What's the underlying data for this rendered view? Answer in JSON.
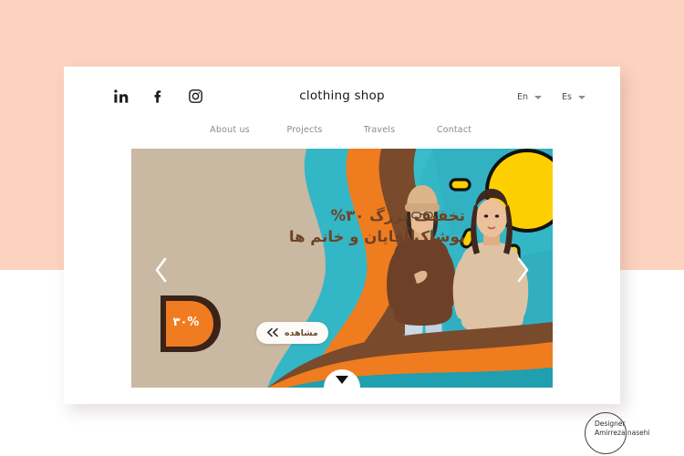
{
  "page": {
    "background_top_color": "#fcd3bf",
    "background_bottom_color": "#ffffff"
  },
  "header": {
    "brand": "clothing shop",
    "social": [
      {
        "name": "linkedin-icon",
        "label": "in"
      },
      {
        "name": "facebook-icon",
        "label": "f"
      },
      {
        "name": "instagram-icon",
        "label": "instagram"
      }
    ],
    "languages": [
      {
        "label": "En"
      },
      {
        "label": "Es"
      }
    ]
  },
  "nav": {
    "items": [
      {
        "label": "About us"
      },
      {
        "label": "Projects"
      },
      {
        "label": "Travels"
      },
      {
        "label": "Contact"
      }
    ]
  },
  "hero": {
    "headline_line1": "تخفیف بزرگ ۳۰%",
    "headline_line2": "پوشاک آقایان و خانم ها",
    "badge_letter": "D",
    "badge_percent": "۳۰%",
    "cta_label": "مشاهده",
    "cta_icon": "double-chevron-left-icon",
    "prev_icon": "chevron-left-icon",
    "next_icon": "chevron-right-icon",
    "scroll_icon": "triangle-down-icon",
    "colors": {
      "panel_beige": "#c9b8a2",
      "teal": "#33b6c6",
      "orange": "#ef7c1f",
      "brown": "#7a4a2c",
      "sun_yellow": "#fcd000",
      "text_brown": "#6d4326"
    }
  },
  "credit": {
    "line1": "Designer",
    "line2": "Amirreza nasehi"
  }
}
